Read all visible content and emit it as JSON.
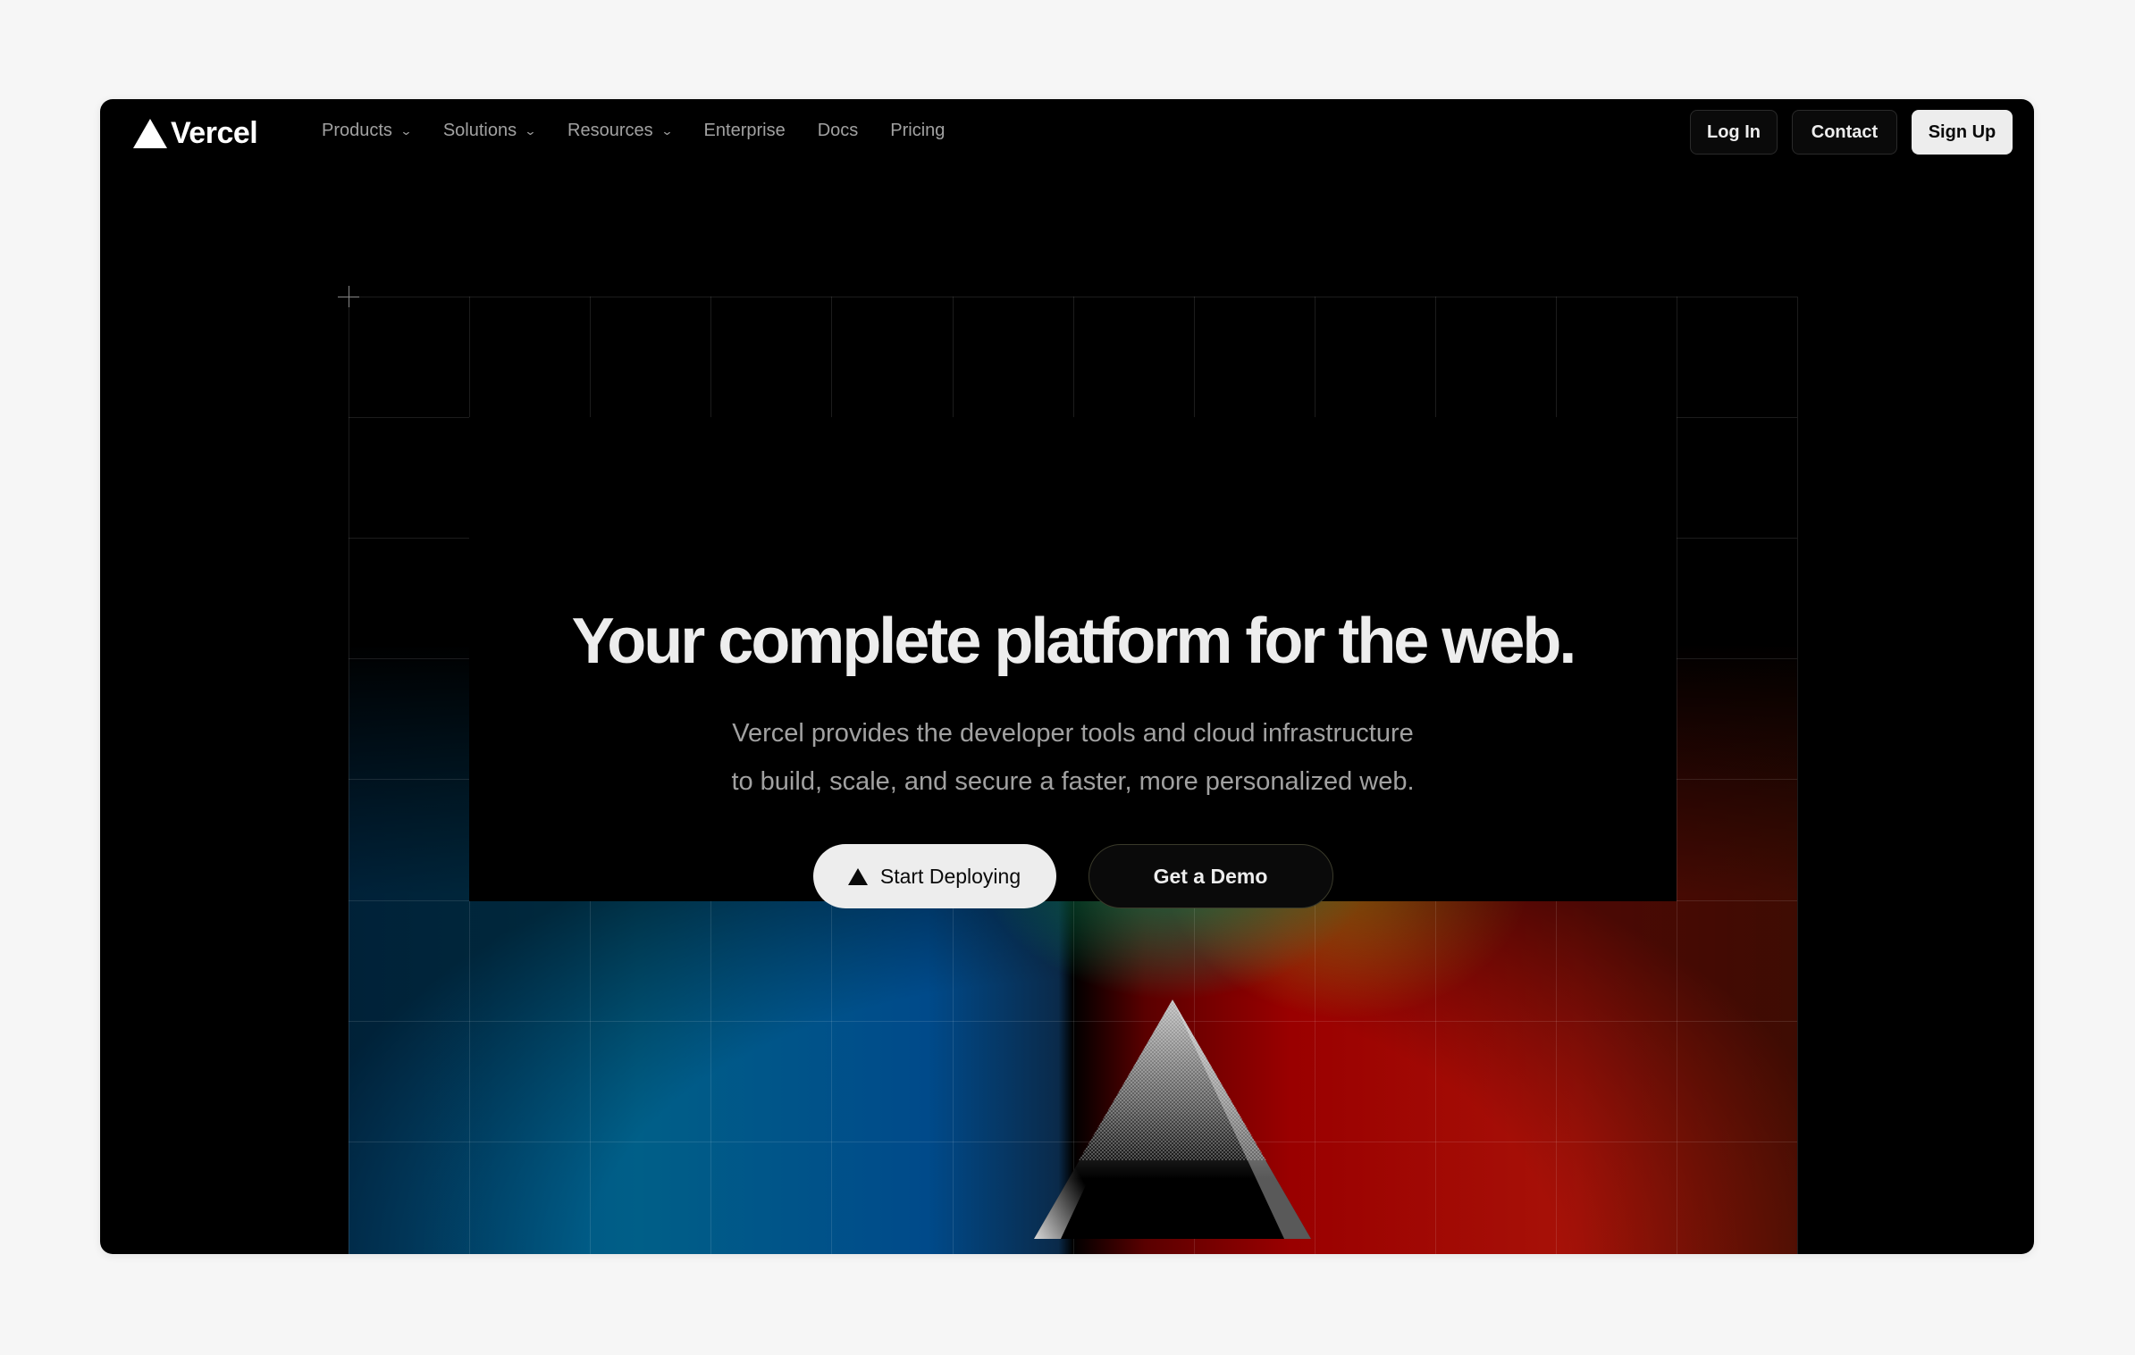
{
  "nav": {
    "brand": "Vercel",
    "items": [
      {
        "label": "Products",
        "has_dropdown": true
      },
      {
        "label": "Solutions",
        "has_dropdown": true
      },
      {
        "label": "Resources",
        "has_dropdown": true
      },
      {
        "label": "Enterprise",
        "has_dropdown": false
      },
      {
        "label": "Docs",
        "has_dropdown": false
      },
      {
        "label": "Pricing",
        "has_dropdown": false
      }
    ],
    "chevron": "⌄",
    "actions": {
      "login": "Log In",
      "contact": "Contact",
      "signup": "Sign Up"
    }
  },
  "hero": {
    "headline": "Your complete platform for the web.",
    "subtitle_line1": "Vercel provides the developer tools and cloud infrastructure",
    "subtitle_line2": "to build, scale, and secure a faster, more personalized web.",
    "primary_cta": "Start Deploying",
    "secondary_cta": "Get a Demo"
  },
  "colors": {
    "background": "#000000",
    "text_primary": "#ededed",
    "text_secondary": "#a1a1a1",
    "gradient_blue": "#004a8a",
    "gradient_green": "#12be78",
    "gradient_gold": "#c89b14",
    "gradient_red": "#9a0000"
  }
}
